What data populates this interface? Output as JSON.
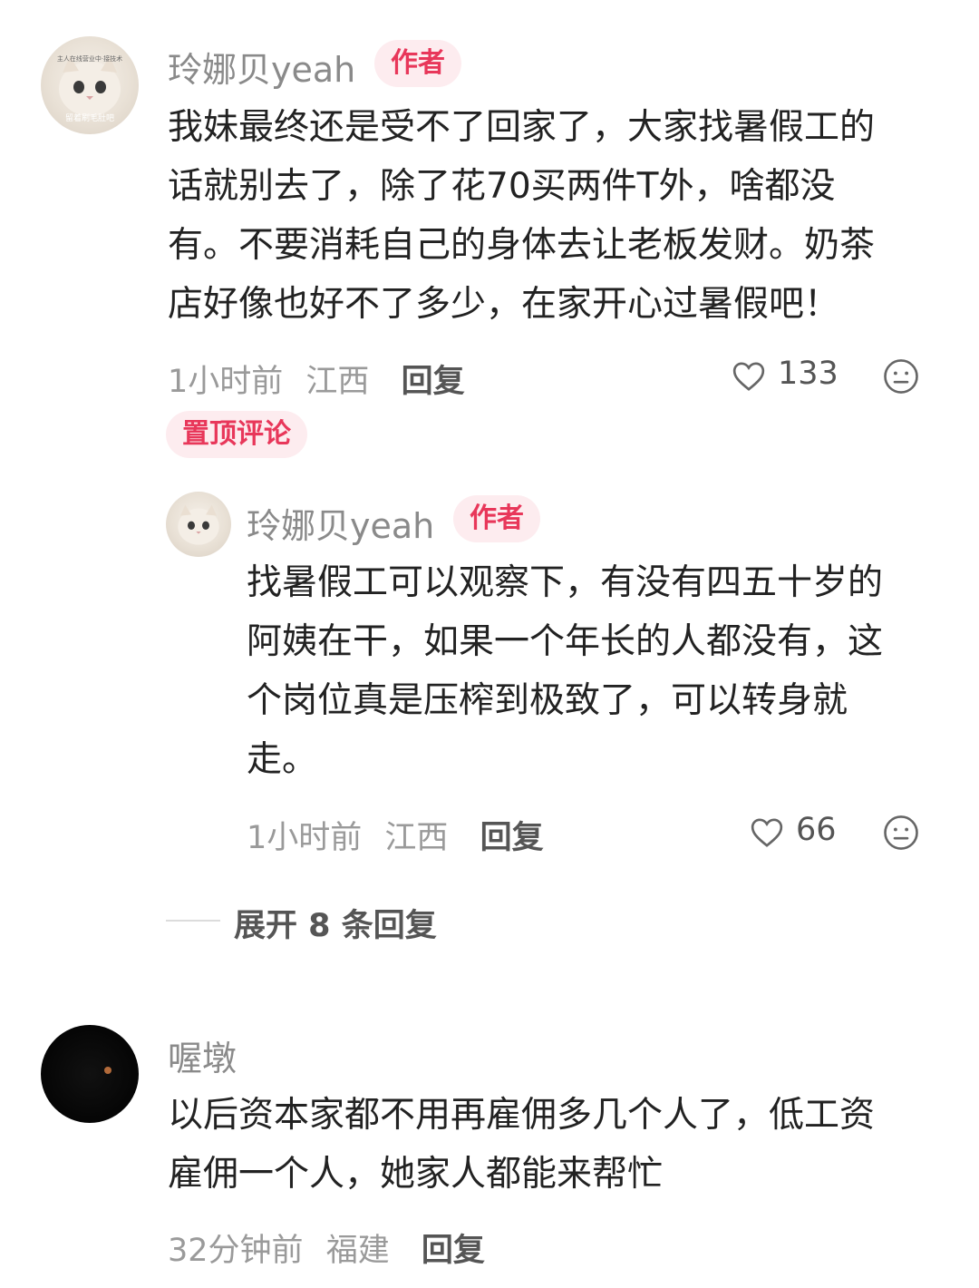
{
  "comments": [
    {
      "username": "玲娜贝yeah",
      "badge": "作者",
      "content_lines": [
        "我妹最终还是受不了回家了，大家找暑假工的",
        "话就别去了，除了花70买两件T外，啥都没",
        "有。不要消耗自己的身体去让老板发财。奶茶",
        "店好像也好不了多少，在家开心过暑假吧！"
      ],
      "time": "1小时前",
      "location": "江西",
      "reply_label": "回复",
      "likes": "133",
      "pin_label": "置顶评论",
      "avatar_text_top": "主人在线营业中·接技术",
      "avatar_text_bottom": "留着刷毛肚吧",
      "reply": {
        "username": "玲娜贝yeah",
        "badge": "作者",
        "content_lines": [
          "找暑假工可以观察下，有没有四五十岁的",
          "阿姨在干，如果一个年长的人都没有，这",
          "个岗位真是压榨到极致了，可以转身就",
          "走。"
        ],
        "time": "1小时前",
        "location": "江西",
        "reply_label": "回复",
        "likes": "66"
      },
      "expand_label": "展开 8 条回复"
    },
    {
      "username": "喔墩",
      "content_lines": [
        "以后资本家都不用再雇佣多几个人了，低工资",
        "雇佣一个人，她家人都能来帮忙"
      ],
      "time": "32分钟前",
      "location": "福建",
      "reply_label": "回复"
    }
  ],
  "colors": {
    "accent": "#e8375a",
    "badge_bg": "#fdecef",
    "muted": "#9a9a9a"
  },
  "icons": {
    "like": "heart-outline-icon",
    "reaction": "neutral-face-icon"
  }
}
